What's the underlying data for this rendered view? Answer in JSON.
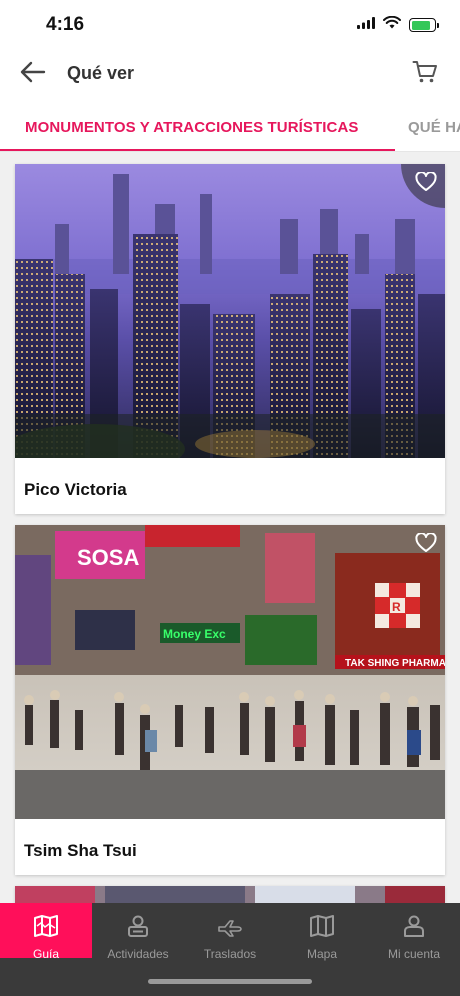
{
  "status": {
    "time": "4:16",
    "battery_level": 0.85,
    "battery_color": "#34c759"
  },
  "header": {
    "title": "Qué ver",
    "back_icon": "arrow-left-icon",
    "cart_icon": "cart-icon"
  },
  "tabs": [
    {
      "label": "MONUMENTOS Y ATRACCIONES TURÍSTICAS",
      "active": true
    },
    {
      "label": "QUÉ HA",
      "active": false
    }
  ],
  "accent_color": "#e6175c",
  "cards": [
    {
      "title": "Pico Victoria",
      "favorite_icon": "heart-outline-icon"
    },
    {
      "title": "Tsim Sha Tsui",
      "favorite_icon": "heart-outline-icon"
    }
  ],
  "photo_signs": [
    "SOSA",
    "Money Exc",
    "TAK SHING PHARMA",
    "R"
  ],
  "bottom_nav": [
    {
      "label": "Guía",
      "icon": "map-book-icon",
      "active": true
    },
    {
      "label": "Actividades",
      "icon": "person-badge-icon",
      "active": false
    },
    {
      "label": "Traslados",
      "icon": "plane-icon",
      "active": false
    },
    {
      "label": "Mapa",
      "icon": "map-icon",
      "active": false
    },
    {
      "label": "Mi cuenta",
      "icon": "user-icon",
      "active": false
    }
  ]
}
